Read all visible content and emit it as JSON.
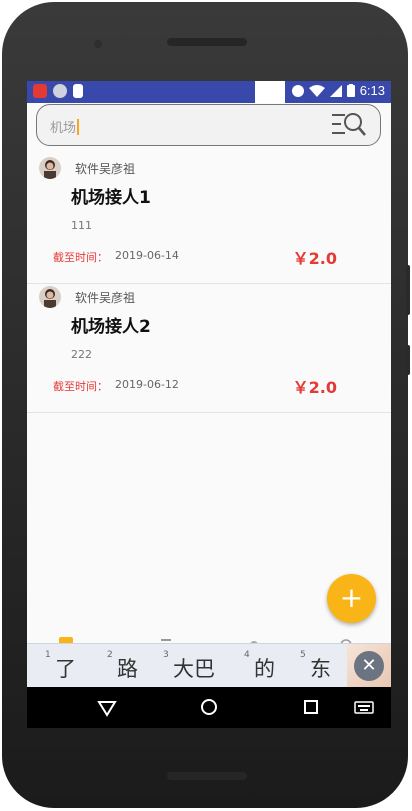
{
  "status_bar": {
    "time": "6:13"
  },
  "search": {
    "value": "机场"
  },
  "tasks": [
    {
      "author": "软件吴彦祖",
      "title": "机场接人1",
      "description": "111",
      "deadline_label": "截至时间：",
      "deadline": "2019-06-14",
      "price": "￥2.0"
    },
    {
      "author": "软件吴彦祖",
      "title": "机场接人2",
      "description": "222",
      "deadline_label": "截至时间：",
      "deadline": "2019-06-12",
      "price": "￥2.0"
    }
  ],
  "fab": {
    "label": "+"
  },
  "ime": {
    "candidates": [
      {
        "num": "1",
        "word": "了"
      },
      {
        "num": "2",
        "word": "路"
      },
      {
        "num": "3",
        "word": "大巴"
      },
      {
        "num": "4",
        "word": "的"
      },
      {
        "num": "5",
        "word": "东"
      }
    ],
    "close_label": "✕"
  },
  "colors": {
    "accent": "#f9b417",
    "status_bar": "#3949ab",
    "price": "#e53935"
  }
}
